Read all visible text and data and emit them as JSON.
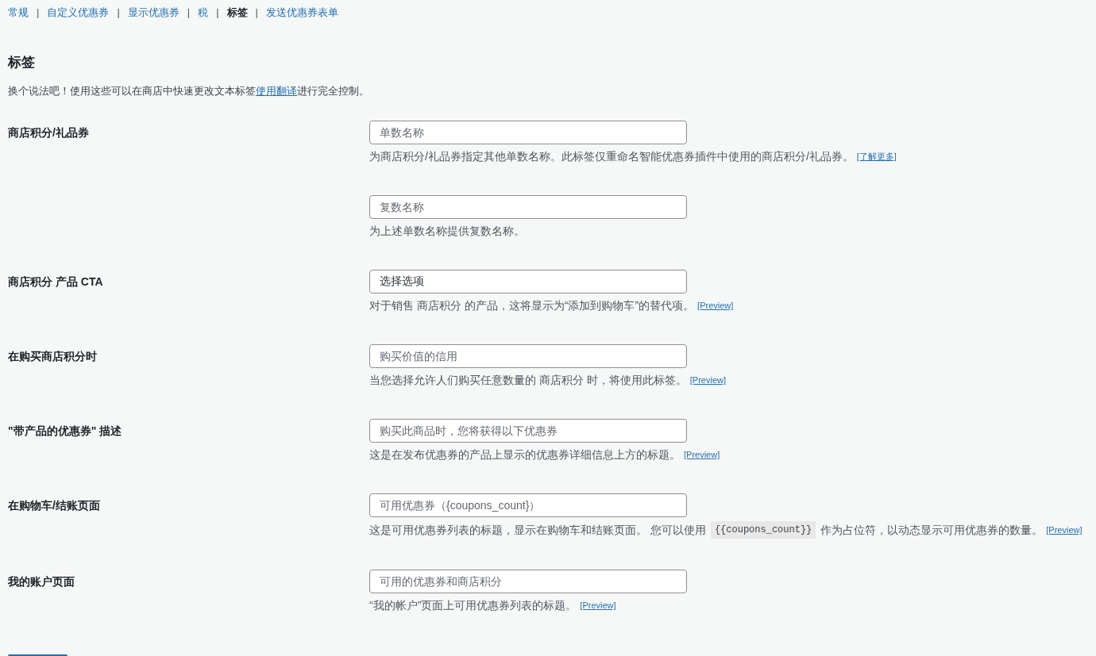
{
  "nav_tabs": [
    {
      "label": "常规",
      "selected": false,
      "separator": "|"
    },
    {
      "label": "自定义优惠券",
      "selected": false,
      "separator": "|"
    },
    {
      "label": "显示优惠券",
      "selected": false,
      "separator": "|"
    },
    {
      "label": "税",
      "selected": false,
      "separator": "|"
    },
    {
      "label": "标签",
      "selected": true,
      "separator": "|"
    },
    {
      "label": "发送优惠券表单",
      "selected": false
    }
  ],
  "heading": "标签",
  "intro": {
    "text_before": "换个说法吧！使用这些可以在商店中快速更改文本标签",
    "link": "使用翻译",
    "text_after": "进行完全控制。"
  },
  "settings": [
    {
      "label": "商店积分/礼品券",
      "fields": [
        {
          "placeholder": "单数名称",
          "description": [
            {
              "kind": "text",
              "text": "为商店积分/礼品券指定其他单数名称。此标签仅重命名智能优惠券插件中使用的商店积分/礼品券。"
            },
            {
              "kind": "link",
              "text": "[了解更多]"
            }
          ]
        },
        {
          "placeholder": "复数名称",
          "description": [
            {
              "kind": "text",
              "text": "为上述单数名称提供复数名称。"
            }
          ]
        }
      ]
    },
    {
      "label": "商店积分 产品 CTA",
      "fields": [
        {
          "value": "选择选项",
          "description": [
            {
              "kind": "text",
              "text": "对于销售 商店积分 的产品，这将显示为“添加到购物车”的替代项。"
            },
            {
              "kind": "link",
              "text": "[Preview]"
            }
          ]
        }
      ]
    },
    {
      "label": "在购买商店积分时",
      "fields": [
        {
          "placeholder": "购买价值的信用",
          "description": [
            {
              "kind": "text",
              "text": "当您选择允许人们购买任意数量的 商店积分 时，将使用此标签。"
            },
            {
              "kind": "link",
              "text": "[Preview]"
            }
          ]
        }
      ]
    },
    {
      "label": "\"带产品的优惠券\" 描述",
      "fields": [
        {
          "placeholder": "购买此商品时，您将获得以下优惠券",
          "description": [
            {
              "kind": "text",
              "text": "这是在发布优惠券的产品上显示的优惠券详细信息上方的标题。"
            },
            {
              "kind": "link",
              "text": "[Preview]"
            }
          ]
        }
      ]
    },
    {
      "label": "在购物车/结账页面",
      "fields": [
        {
          "placeholder": "可用优惠券（{coupons_count}）",
          "description": [
            {
              "kind": "text",
              "text": "这是可用优惠券列表的标题，显示在购物车和结账页面。 您可以使用"
            },
            {
              "kind": "code",
              "text": "{{coupons_count}}"
            },
            {
              "kind": "text",
              "text": "作为占位符，以动态显示可用优惠券的数量。"
            },
            {
              "kind": "link",
              "text": "[Preview]"
            }
          ]
        }
      ]
    },
    {
      "label": "我的账户页面",
      "fields": [
        {
          "placeholder": "可用的优惠券和商店积分",
          "description": [
            {
              "kind": "text",
              "text": "“我的帐户”页面上可用优惠券列表的标题。"
            },
            {
              "kind": "link",
              "text": "[Preview]"
            }
          ]
        }
      ]
    }
  ]
}
